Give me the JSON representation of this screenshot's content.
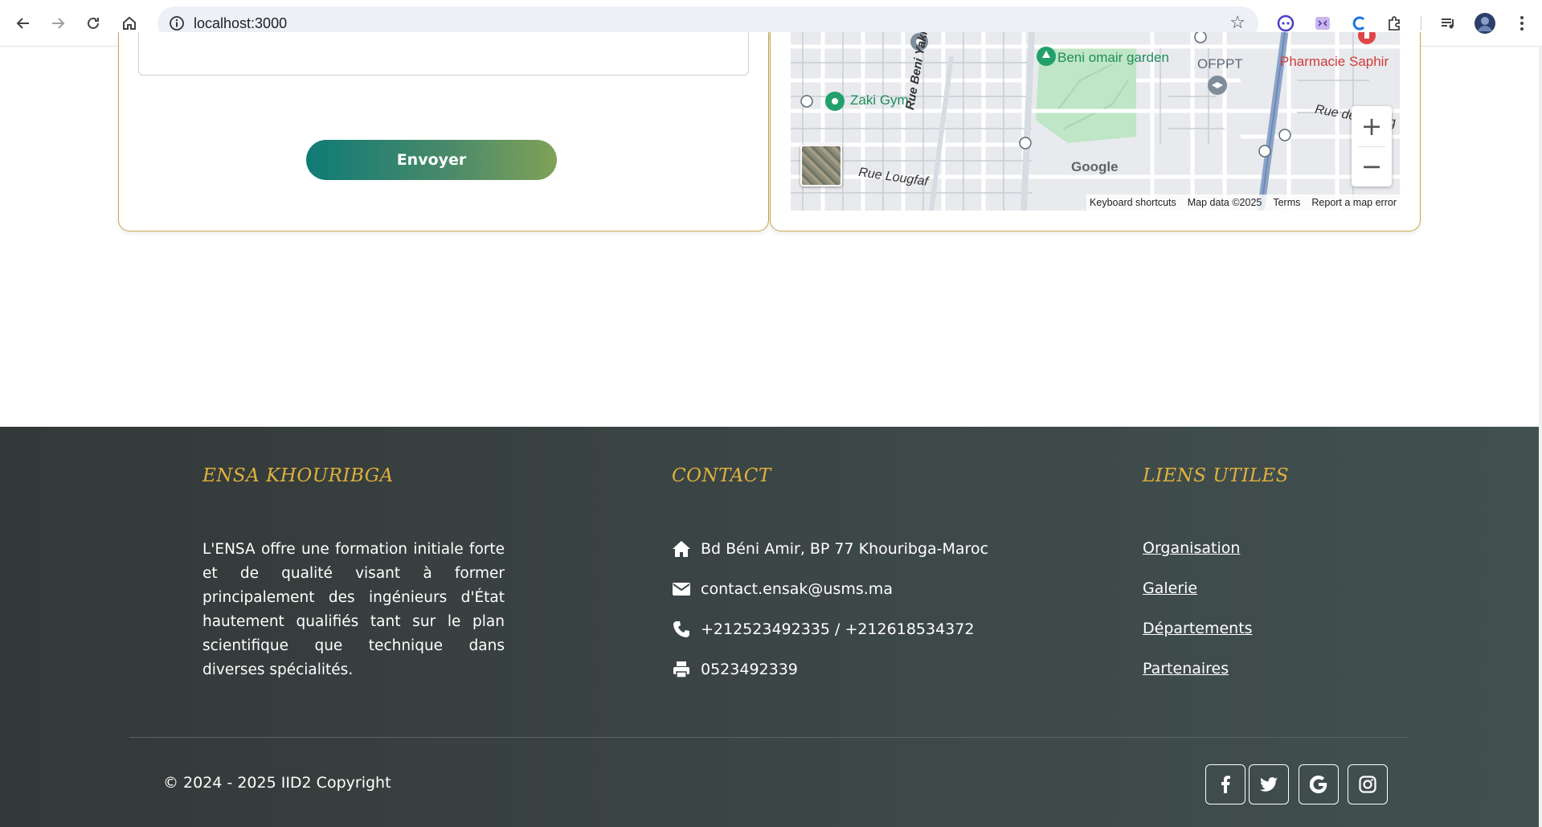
{
  "browser": {
    "url": "localhost:3000",
    "icons": [
      "back-icon",
      "forward-icon",
      "reload-icon",
      "home-icon",
      "site-info-icon",
      "bookmark-star-icon",
      "extension-icons",
      "media-controls-icon",
      "profile-avatar",
      "menu-icon"
    ]
  },
  "form": {
    "submit_label": "Envoyer"
  },
  "map": {
    "places": {
      "beni_omair_garden": "Beni omair garden",
      "ofppt": "OFPPT",
      "pharmacie_saphir": "Pharmacie Saphir",
      "zaki_gym": "Zaki Gym",
      "rue_beni_yakhlef": "Rue Beni Yakhlef",
      "rue_lougfaf": "Rue Lougfaf",
      "rue_partial": "Rue de",
      "edge_partial": "g"
    },
    "logo": "Google",
    "attribution": {
      "shortcuts": "Keyboard shortcuts",
      "map_data": "Map data ©2025",
      "terms": "Terms",
      "report": "Report a map error"
    },
    "zoom_in": "+",
    "zoom_out": "−"
  },
  "footer": {
    "about_title": "ENSA KHOURIBGA",
    "about_text": "L'ENSA offre une formation initiale forte et de qualité visant à former principalement des ingénieurs d'État hautement qualifiés tant sur le plan scientifique que technique dans diverses spécialités.",
    "contact_title": "CONTACT",
    "contact": {
      "address": "Bd Béni Amir, BP 77 Khouribga-Maroc",
      "email": "contact.ensak@usms.ma",
      "phone": "+212523492335 / +212618534372",
      "fax": "0523492339"
    },
    "links_title": "LIENS UTILES",
    "links": [
      "Organisation",
      "Galerie",
      "Départements",
      "Partenaires"
    ],
    "copyright": "© 2024 - 2025 IID2 Copyright",
    "social": [
      "facebook-icon",
      "twitter-icon",
      "google-icon",
      "instagram-icon"
    ]
  },
  "colors": {
    "accent_gold": "#e0b13b",
    "button_start": "#0f7b76",
    "button_end": "#80a159",
    "footer_bg": "#3d4848"
  }
}
